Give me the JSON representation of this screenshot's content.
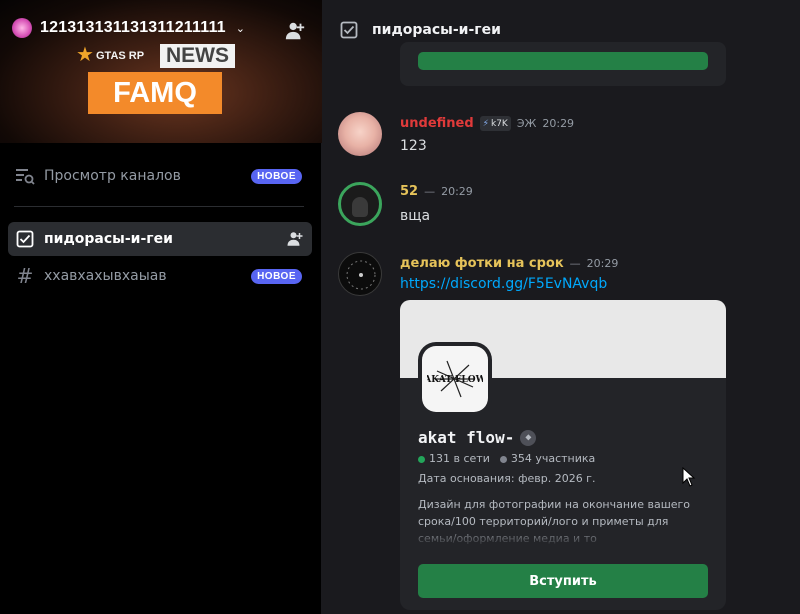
{
  "server": {
    "name": "121313131131311211111",
    "icon": "server-avatar-pink",
    "banner": {
      "star_icon": "star-icon",
      "gtas_text": "GTAS RP",
      "news_text": "NEWS",
      "famq_text": "FAMQ"
    }
  },
  "sidebar": {
    "browse": {
      "label": "Просмотр каналов",
      "badge": "НОВОЕ",
      "icon": "browse-channels-icon"
    },
    "channels": [
      {
        "label": "пидорасы-и-геи",
        "icon": "rules-channel-icon",
        "active": true
      },
      {
        "label": "ххавхахывхаыав",
        "icon": "hash-icon",
        "badge": "НОВОЕ",
        "active": false
      }
    ]
  },
  "header": {
    "channel_title": "пидорасы-и-геи",
    "icon": "rules-channel-icon"
  },
  "messages": [
    {
      "username": "undefined",
      "username_color": "#e03a3a",
      "tag": "k7K",
      "extra": "ЭЖ",
      "time": "20:29",
      "text": "123"
    },
    {
      "username": "52",
      "username_color": "#e6c35a",
      "separator": "—",
      "time": "20:29",
      "text": "вща"
    },
    {
      "username": "делаю фотки на срок",
      "username_color": "#e6c35a",
      "separator": "—",
      "time": "20:29",
      "link": "https://discord.gg/F5EvNAvqb"
    }
  ],
  "invite_embed": {
    "server_name": "akat flow-",
    "icon_text": "AKAT FLOW",
    "online": "131 в сети",
    "members": "354 участника",
    "founded": "Дата основания: февр. 2026 г.",
    "description": "Дизайн для фотографии на окончание вашего срока/100 территорий/лого и приметы для семьи/оформление медиа и то",
    "join_label": "Вступить"
  },
  "colors": {
    "accent": "#5865f2",
    "online": "#23a55a",
    "offline": "#80848e",
    "join": "#248046",
    "link": "#00a8fc"
  }
}
